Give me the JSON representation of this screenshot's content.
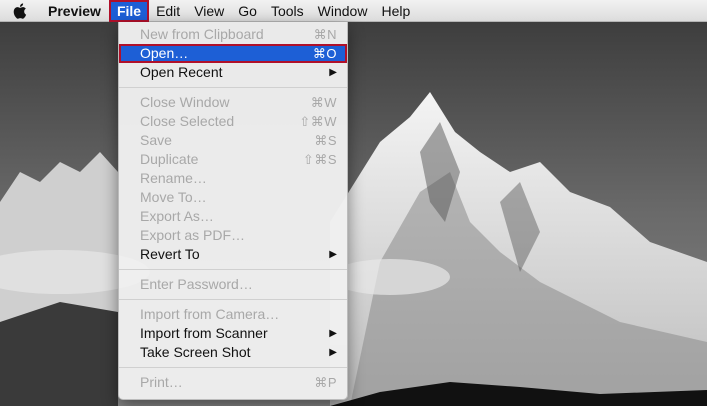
{
  "menubar": {
    "app_name": "Preview",
    "menus": [
      "File",
      "Edit",
      "View",
      "Go",
      "Tools",
      "Window",
      "Help"
    ]
  },
  "file_menu": {
    "items": [
      {
        "label": "New from Clipboard",
        "shortcut": "⌘N",
        "disabled": true
      },
      {
        "label": "Open…",
        "shortcut": "⌘O",
        "disabled": false,
        "highlighted": true
      },
      {
        "label": "Open Recent",
        "submenu": true,
        "disabled": false
      },
      {
        "separator": true
      },
      {
        "label": "Close Window",
        "shortcut": "⌘W",
        "disabled": true
      },
      {
        "label": "Close Selected",
        "shortcut": "⇧⌘W",
        "disabled": true
      },
      {
        "label": "Save",
        "shortcut": "⌘S",
        "disabled": true
      },
      {
        "label": "Duplicate",
        "shortcut": "⇧⌘S",
        "disabled": true
      },
      {
        "label": "Rename…",
        "disabled": true
      },
      {
        "label": "Move To…",
        "disabled": true
      },
      {
        "label": "Export As…",
        "disabled": true
      },
      {
        "label": "Export as PDF…",
        "disabled": true
      },
      {
        "label": "Revert To",
        "submenu": true,
        "disabled": false
      },
      {
        "separator": true
      },
      {
        "label": "Enter Password…",
        "disabled": true
      },
      {
        "separator": true
      },
      {
        "label": "Import from Camera…",
        "disabled": true
      },
      {
        "label": "Import from Scanner",
        "submenu": true,
        "disabled": false
      },
      {
        "label": "Take Screen Shot",
        "submenu": true,
        "disabled": false
      },
      {
        "separator": true
      },
      {
        "label": "Print…",
        "shortcut": "⌘P",
        "disabled": true
      }
    ],
    "submenu_arrow": "▶"
  },
  "colors": {
    "highlight": "#1d5fd6",
    "highlight_outline": "#b0102a",
    "disabled_text": "#a8a8a8"
  },
  "icons": {
    "apple": "apple-logo-icon"
  }
}
